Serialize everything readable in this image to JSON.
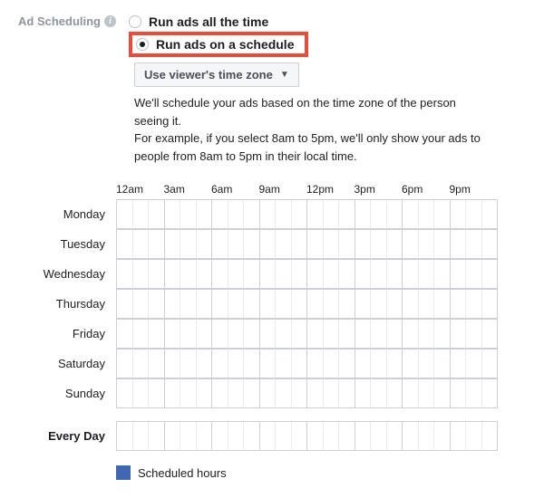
{
  "section_label": "Ad Scheduling",
  "radio": {
    "all_time": "Run ads all the time",
    "on_schedule": "Run ads on a schedule"
  },
  "timezone_dropdown": "Use viewer's time zone",
  "description": {
    "line1": "We'll schedule your ads based on the time zone of the person seeing it.",
    "line2": "For example, if you select 8am to 5pm, we'll only show your ads to people from 8am to 5pm in their local time."
  },
  "time_labels": {
    "t0": "12am",
    "t1": "3am",
    "t2": "6am",
    "t3": "9am",
    "t4": "12pm",
    "t5": "3pm",
    "t6": "6pm",
    "t7": "9pm"
  },
  "days": {
    "mon": "Monday",
    "tue": "Tuesday",
    "wed": "Wednesday",
    "thu": "Thursday",
    "fri": "Friday",
    "sat": "Saturday",
    "sun": "Sunday"
  },
  "every_day": "Every Day",
  "legend": "Scheduled hours"
}
